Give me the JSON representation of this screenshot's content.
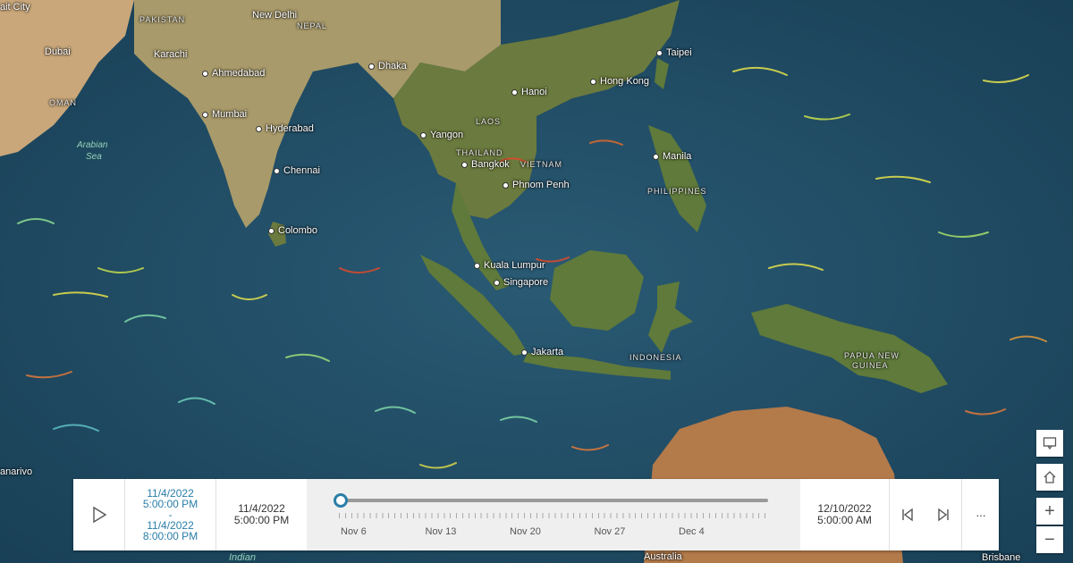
{
  "places": {
    "new_delhi": "New Delhi",
    "karachi": "Karachi",
    "dubai": "Dubai",
    "ahmedabad": "Ahmedabad",
    "mumbai": "Mumbai",
    "hyderabad": "Hyderabad",
    "chennai": "Chennai",
    "colombo": "Colombo",
    "dhaka": "Dhaka",
    "yangon": "Yangon",
    "hanoi": "Hanoi",
    "bangkok": "Bangkok",
    "phnom_penh": "Phnom Penh",
    "hong_kong": "Hong Kong",
    "taipei": "Taipei",
    "manila": "Manila",
    "kuala_lumpur": "Kuala Lumpur",
    "singapore": "Singapore",
    "jakarta": "Jakarta",
    "brisbane": "Brisbane",
    "city_cut": "ait City",
    "antananarivo_cut": "anarivo"
  },
  "countries": {
    "pakistan": "PAKISTAN",
    "nepal": "NEPAL",
    "oman": "OMAN",
    "laos": "LAOS",
    "thailand": "THAILAND",
    "vietnam": "VIETNAM",
    "philippines": "PHILIPPINES",
    "indonesia": "INDONESIA",
    "papua_line1": "PAPUA NEW",
    "papua_line2": "GUINEA",
    "australia": "Australia"
  },
  "seas": {
    "arabian_line1": "Arabian",
    "arabian_line2": "Sea",
    "indian": "Indian"
  },
  "timeline": {
    "range_start_date": "11/4/2022",
    "range_start_time": "5:00:00 PM",
    "range_sep": "-",
    "range_end_date": "11/4/2022",
    "range_end_time": "8:00:00 PM",
    "start_date": "11/4/2022",
    "start_time": "5:00:00 PM",
    "end_date": "12/10/2022",
    "end_time": "5:00:00 AM",
    "ticks": [
      "Nov 6",
      "Nov 13",
      "Nov 20",
      "Nov 27",
      "Dec 4"
    ],
    "more_label": "···",
    "position_fraction": 0.0
  },
  "controls": {
    "zoom_in": "+",
    "zoom_out": "−"
  },
  "icons": {
    "play": "play-icon",
    "prev": "previous-icon",
    "next": "next-icon",
    "more": "more-icon",
    "legend": "legend-icon",
    "home": "home-icon"
  },
  "colors": {
    "ocean": "#1d4a63",
    "land": "#6b7a3e",
    "accent": "#2a7ea8"
  }
}
